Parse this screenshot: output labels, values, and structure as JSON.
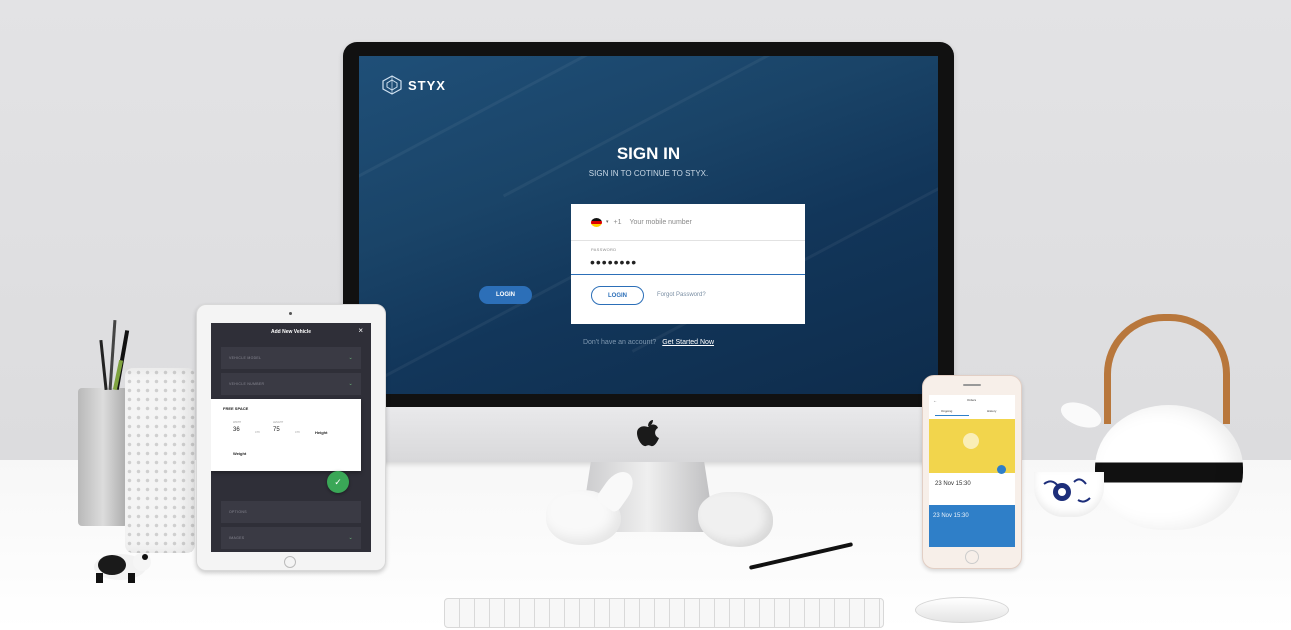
{
  "app": {
    "brand": "STYX"
  },
  "signin": {
    "title": "SIGN IN",
    "subtitle": "SIGN IN TO COTINUE TO STYX.",
    "phone_prefix": "+1",
    "phone_placeholder": "Your mobile number",
    "password_label": "PASSWORD",
    "password_value": "••••••••",
    "login_label": "LOGIN",
    "forgot_label": "Forgot Password?",
    "side_login_label": "LOGIN",
    "no_account_text": "Don't have an account?",
    "get_started_label": "Get Started Now"
  },
  "ipad": {
    "title": "Add New Vehicle",
    "close": "×",
    "rows": [
      "VEHICLE MODEL",
      "VEHICLE NUMBER",
      "OPTIONS",
      "IMAGES"
    ],
    "card": {
      "title": "FREE SPACE",
      "width_label": "WIDTH",
      "width_value": "36",
      "length_label": "LENGHT",
      "length_value": "75",
      "unit": "cm",
      "height_label": "Height",
      "weight_label": "Weight"
    },
    "fab_icon": "✓"
  },
  "iphone": {
    "header": "Orders",
    "tab1": "Ongoing",
    "tab2": "History",
    "date1": "23 Nov 15:30",
    "date2": "23 Nov 15:30"
  },
  "colors": {
    "accent": "#2c6fb8",
    "screen_bg": "#1a4468",
    "fab": "#3aa757",
    "phone_yellow": "#f2d54c"
  }
}
